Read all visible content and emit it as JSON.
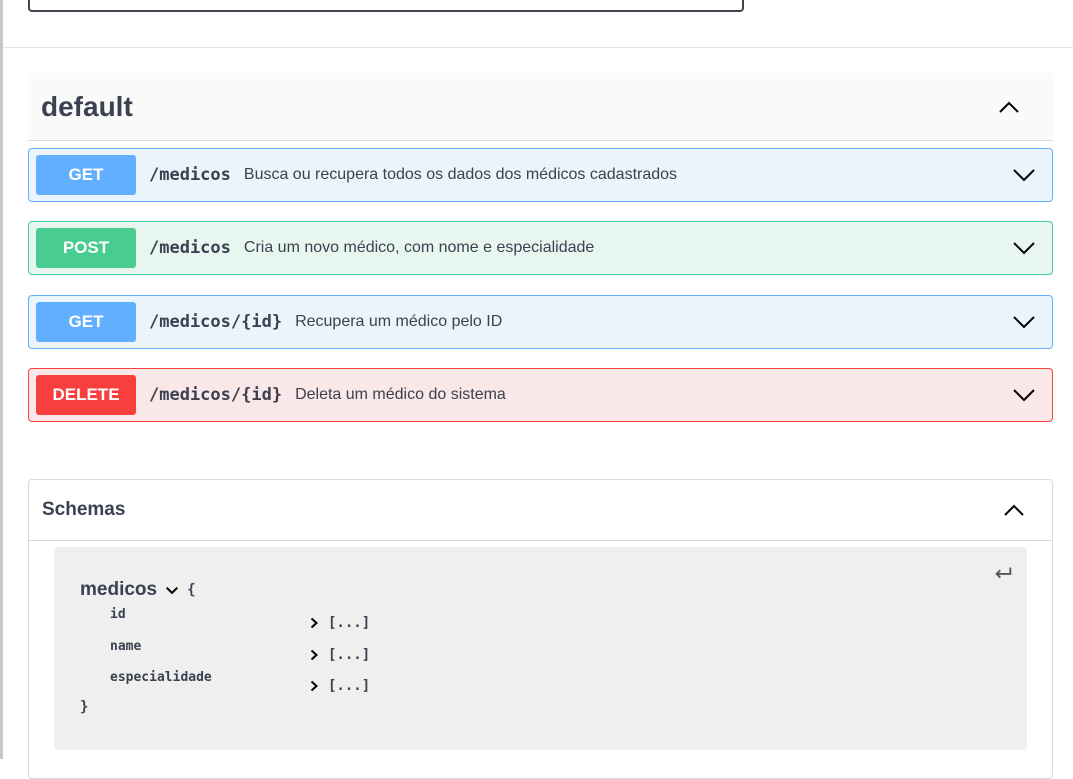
{
  "tag": {
    "title": "default"
  },
  "operations": [
    {
      "method": "GET",
      "path": "/medicos",
      "summary": "Busca ou recupera todos os dados dos médicos cadastrados"
    },
    {
      "method": "POST",
      "path": "/medicos",
      "summary": "Cria um novo médico, com nome e especialidade"
    },
    {
      "method": "GET",
      "path": "/medicos/{id}",
      "summary": "Recupera um médico pelo ID"
    },
    {
      "method": "DELETE",
      "path": "/medicos/{id}",
      "summary": "Deleta um médico do sistema"
    }
  ],
  "schemas": {
    "title": "Schemas",
    "model": {
      "name": "medicos",
      "open_brace": "{",
      "close_brace": "}",
      "properties": [
        {
          "name": "id",
          "value": "[...]"
        },
        {
          "name": "name",
          "value": "[...]"
        },
        {
          "name": "especialidade",
          "value": "[...]"
        }
      ]
    }
  },
  "colors": {
    "get": "#61affe",
    "post": "#49cc90",
    "delete": "#f93e3e",
    "text": "#3b4151"
  },
  "icons": {
    "tag_toggle": "chevron-up-icon",
    "op_toggle": "chevron-down-icon",
    "schemas_toggle": "chevron-up-icon",
    "model_toggle": "chevron-down-icon",
    "prop_expand": "chevron-right-icon",
    "copy": "return-arrow-icon"
  }
}
